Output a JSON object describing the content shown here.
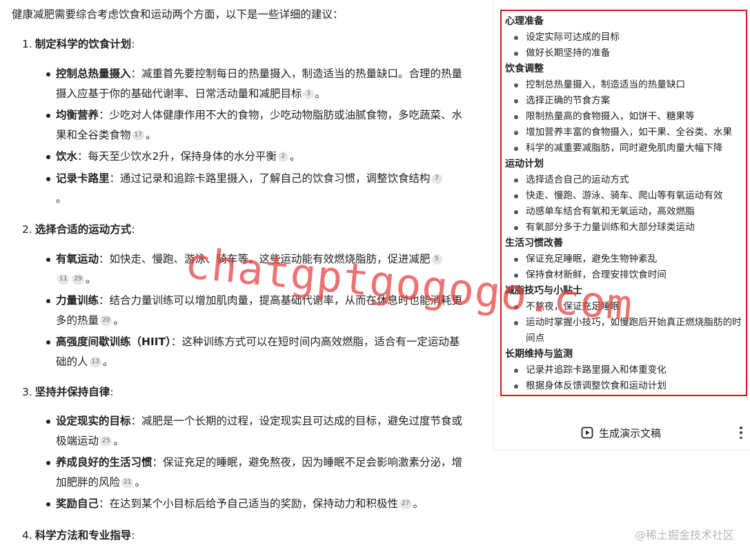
{
  "answer": {
    "intro": "健康减肥需要综合考虑饮食和运动两个方面，以下是一些详细的建议：",
    "sections": [
      {
        "num": "1.",
        "title": "制定科学的饮食计划",
        "suffix": ":",
        "bullets": [
          {
            "title": "控制总热量摄入",
            "sep": "：",
            "text": "减重首先要控制每日的热量摄入，制造适当的热量缺口。合理的热量摄入应基于你的基础代谢率、日常活动量和减肥目标",
            "cites": [
              "3"
            ],
            "tail": "。"
          },
          {
            "title": "均衡营养",
            "sep": "：",
            "text": "少吃对人体健康作用不大的食物，少吃动物脂肪或油腻食物，多吃蔬菜、水果和全谷类食物",
            "cites": [
              "17"
            ],
            "tail": "。"
          },
          {
            "title": "饮水",
            "sep": "：",
            "text": "每天至少饮水2升，保持身体的水分平衡",
            "cites": [
              "2"
            ],
            "tail": "。"
          },
          {
            "title": "记录卡路里",
            "sep": "：",
            "text": "通过记录和追踪卡路里摄入，了解自己的饮食习惯，调整饮食结构",
            "cites": [
              "7"
            ],
            "tail": "。"
          }
        ]
      },
      {
        "num": "2.",
        "title": "选择合适的运动方式",
        "suffix": ":",
        "bullets": [
          {
            "title": "有氧运动",
            "sep": "：",
            "text": "如快走、慢跑、游泳、骑车等，这些运动能有效燃烧脂肪，促进减肥",
            "cites": [
              "5",
              "11",
              "29"
            ],
            "tail": "。"
          },
          {
            "title": "力量训练",
            "sep": "：",
            "text": "结合力量训练可以增加肌肉量，提高基础代谢率，从而在休息时也能消耗更多的热量",
            "cites": [
              "20"
            ],
            "tail": "。"
          },
          {
            "title": "高强度间歇训练（HIIT）",
            "sep": "：",
            "text": "这种训练方式可以在短时间内高效燃脂，适合有一定运动基础的人",
            "cites": [
              "13"
            ],
            "tail": "。"
          }
        ]
      },
      {
        "num": "3.",
        "title": "坚持并保持自律",
        "suffix": ":",
        "bullets": [
          {
            "title": "设定现实的目标",
            "sep": "：",
            "text": "减肥是一个长期的过程，设定现实且可达成的目标，避免过度节食或极端运动",
            "cites": [
              "25"
            ],
            "tail": "。"
          },
          {
            "title": "养成良好的生活习惯",
            "sep": "：",
            "text": "保证充足的睡眠，避免熬夜，因为睡眠不足会影响激素分泌，增加肥胖的风险",
            "cites": [
              "21"
            ],
            "tail": "。"
          },
          {
            "title": "奖励自己",
            "sep": "：",
            "text": "在达到某个小目标后给予自己适当的奖励，保持动力和积极性",
            "cites": [
              "27"
            ],
            "tail": "。"
          }
        ]
      },
      {
        "num": "4.",
        "title": "科学方法和专业指导",
        "suffix": ":",
        "bullets": []
      }
    ]
  },
  "outline": {
    "groups": [
      {
        "title": "心理准备",
        "items": [
          "设定实际可达成的目标",
          "做好长期坚持的准备"
        ]
      },
      {
        "title": "饮食调整",
        "items": [
          "控制总热量摄入，制造适当的热量缺口",
          "选择正确的节食方案",
          "限制热量高的食物摄入，如饼干、糖果等",
          "增加营养丰富的食物摄入，如干果、全谷类、水果",
          "科学的减重要减脂肪，同时避免肌肉量大幅下降"
        ]
      },
      {
        "title": "运动计划",
        "items": [
          "选择适合自己的运动方式",
          "快走、慢跑、游泳、骑车、爬山等有氧运动有效",
          "动感单车结合有氧和无氧运动，高效燃脂",
          "有氧部分多于力量训练和大部分球类运动"
        ]
      },
      {
        "title": "生活习惯改善",
        "items": [
          "保证充足睡眠，避免生物钟紊乱",
          "保持食材新鲜，合理安排饮食时间"
        ]
      },
      {
        "title": "减脂技巧与小贴士",
        "items": [
          "不熬夜，保证充足睡眠",
          "运动时掌握小技巧，如慢跑后开始真正燃烧脂肪的时间点"
        ]
      },
      {
        "title": "长期维持与监测",
        "items": [
          "记录并追踪卡路里摄入和体重变化",
          "根据身体反馈调整饮食和运动计划"
        ]
      }
    ]
  },
  "actions": {
    "generate_label": "生成演示文稿",
    "generate_icon": "play-square-icon",
    "more_icon": "more-vertical-icon"
  },
  "overlays": {
    "watermark": "chatgptgogogo.com",
    "site_mark": "@稀土掘金技术社区"
  }
}
